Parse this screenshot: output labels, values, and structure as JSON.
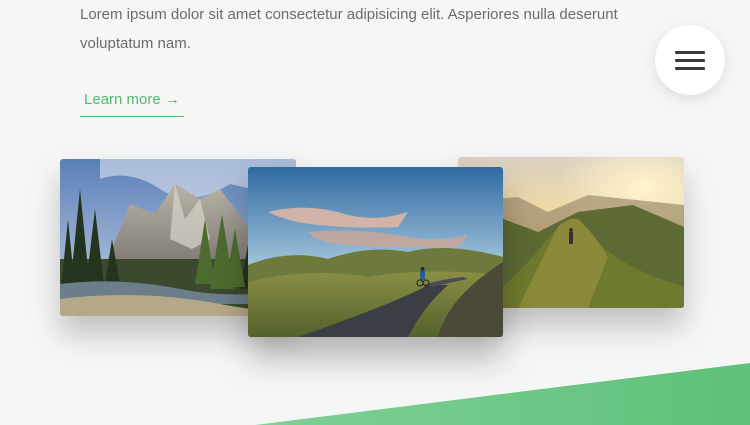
{
  "intro": {
    "text": "Lorem ipsum dolor sit amet consectetur adipisicing elit. Asperiores nulla deserunt voluptatum nam."
  },
  "cta": {
    "label": "Learn more →"
  },
  "menu": {
    "icon": "hamburger-menu-icon"
  },
  "colors": {
    "accent": "#4fba6f",
    "background": "#f6f6f6",
    "text": "#6b6b6b"
  }
}
